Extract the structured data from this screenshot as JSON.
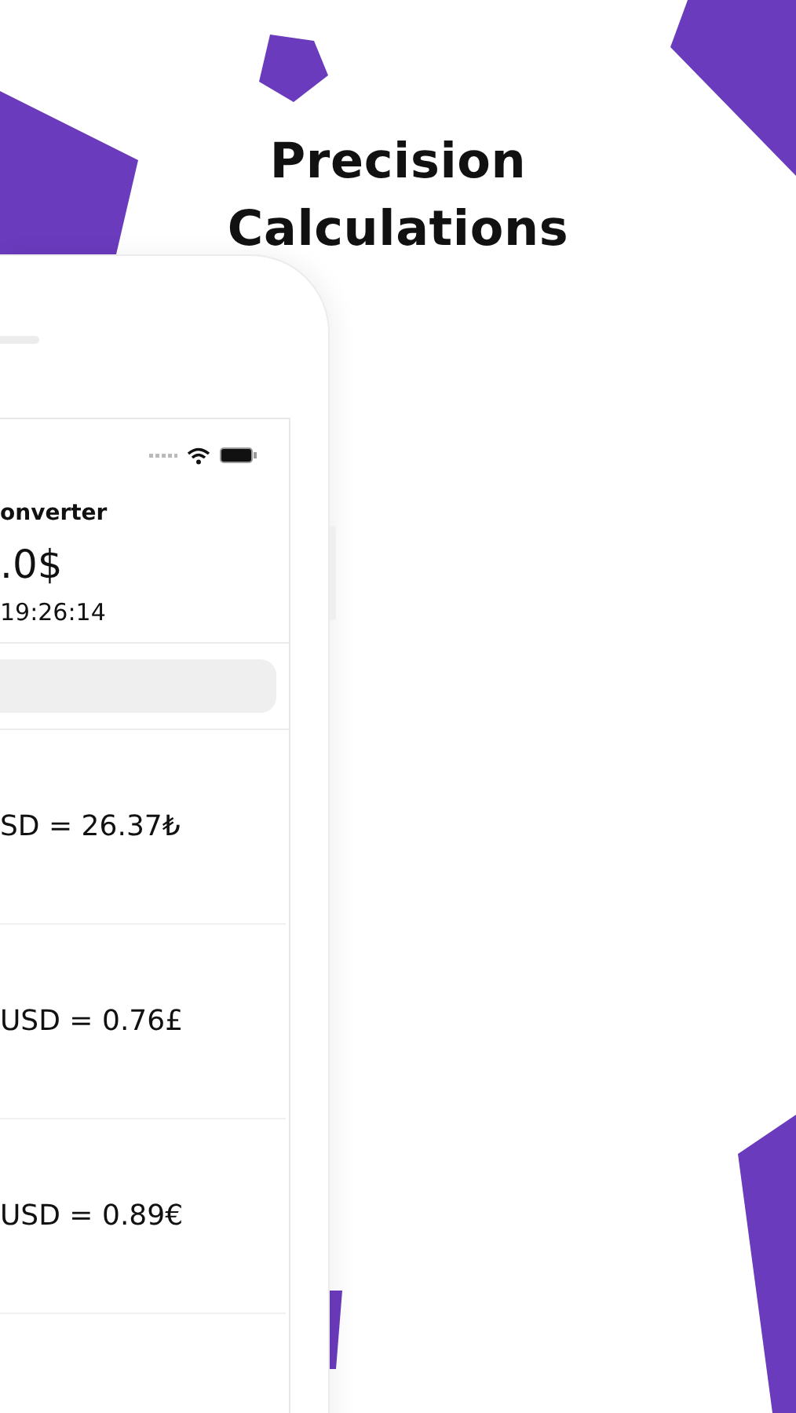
{
  "headline": [
    "Precision",
    "Calculations"
  ],
  "screen": {
    "title": "onverter",
    "amount": ".0$",
    "updated": "19:26:14",
    "rates": [
      {
        "text": "SD = 26.37₺"
      },
      {
        "text": "USD = 0.76£"
      },
      {
        "text": "USD = 0.89€"
      }
    ]
  }
}
